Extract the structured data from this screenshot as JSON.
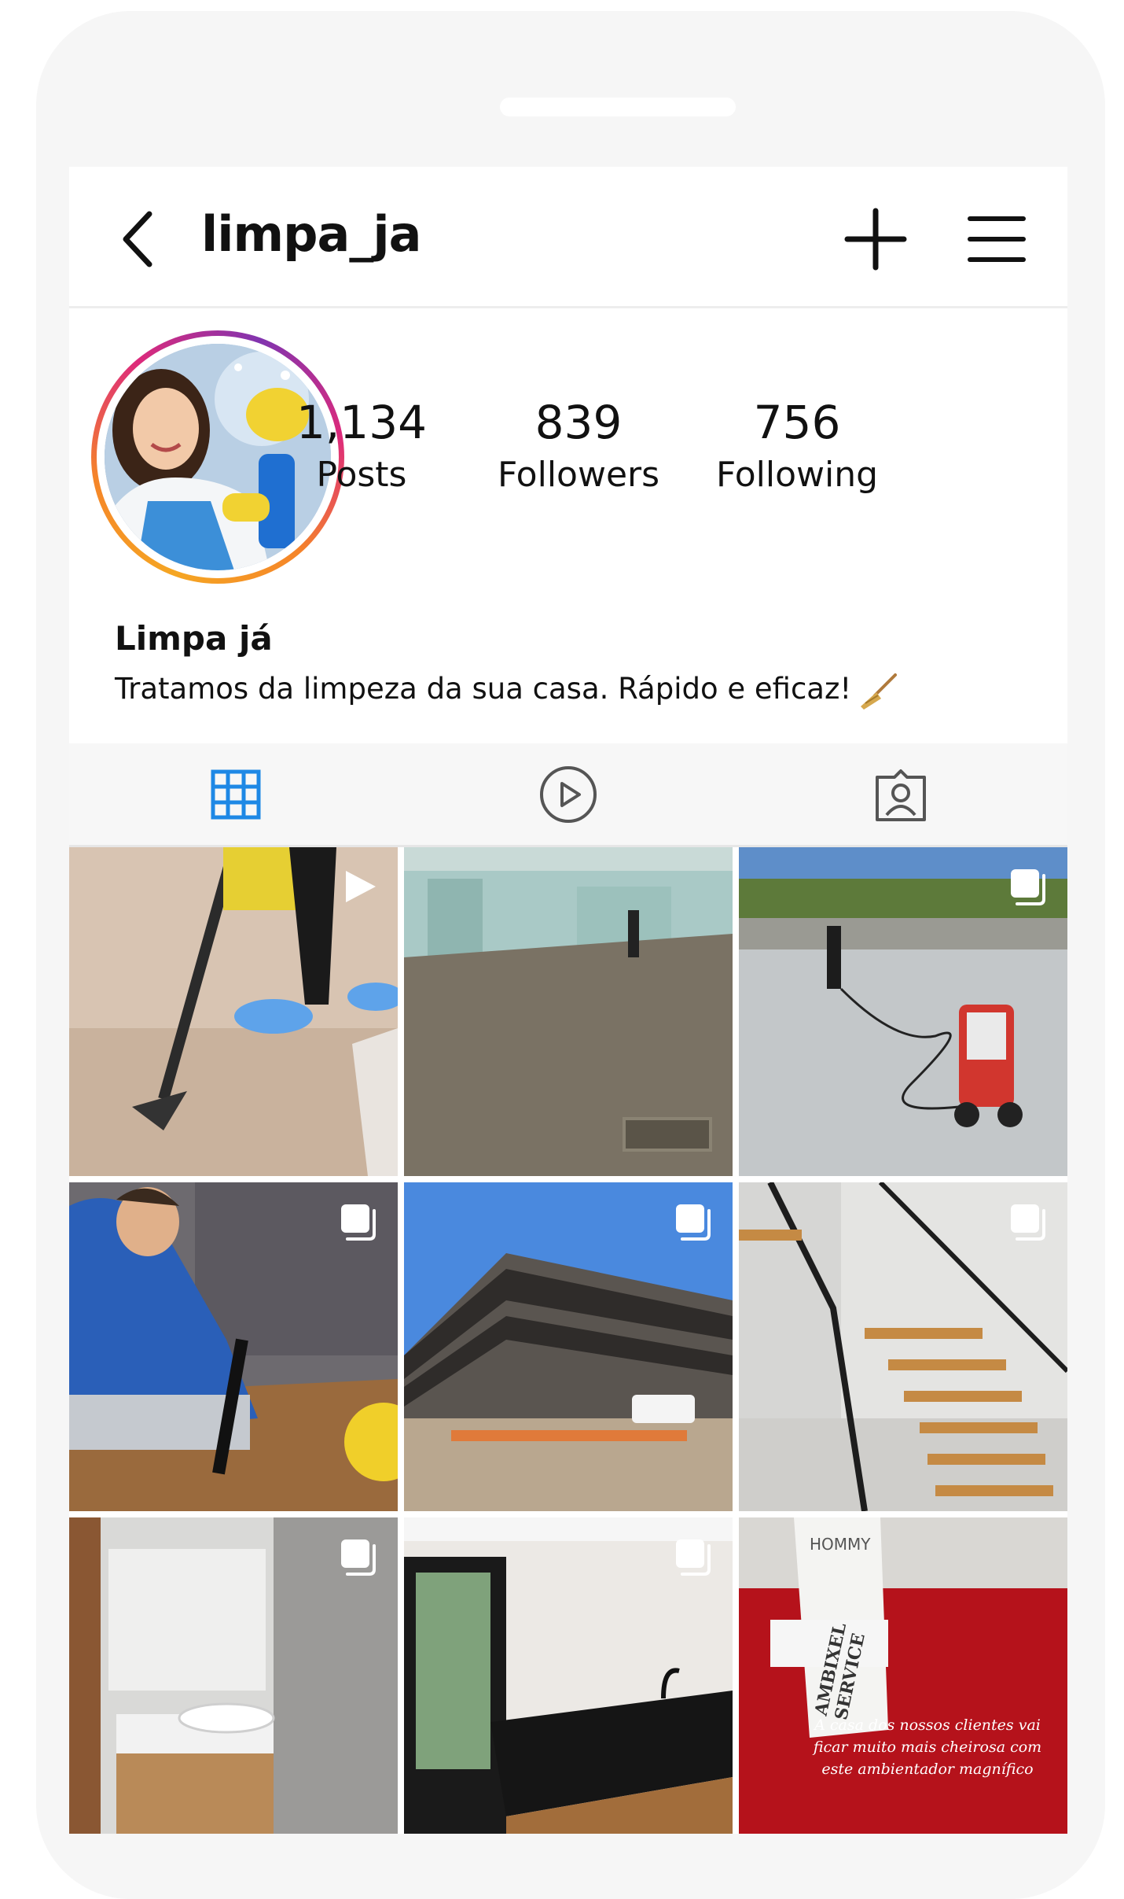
{
  "header": {
    "username": "limpa_ja"
  },
  "profile": {
    "stats": [
      {
        "value": "1,134",
        "label": "Posts"
      },
      {
        "value": "839",
        "label": "Followers"
      },
      {
        "value": "756",
        "label": "Following"
      }
    ],
    "display_name": "Limpa já",
    "bio": "Tratamos da limpeza da sua casa. Rápido e eficaz!"
  },
  "tabs": [
    {
      "icon": "grid-icon",
      "active": true
    },
    {
      "icon": "reels-play-icon",
      "active": false
    },
    {
      "icon": "tagged-person-icon",
      "active": false
    }
  ],
  "colors": {
    "accent_active_tab": "#1e88e5",
    "ring_start": "#f58529",
    "ring_mid": "#dd2a7b",
    "ring_end": "#8134af"
  },
  "posts": [
    {
      "badge": "video-icon"
    },
    {
      "badge": "none"
    },
    {
      "badge": "carousel-icon"
    },
    {
      "badge": "carousel-icon"
    },
    {
      "badge": "carousel-icon"
    },
    {
      "badge": "carousel-icon"
    },
    {
      "badge": "carousel-icon"
    },
    {
      "badge": "carousel-icon"
    },
    {
      "badge": "none"
    }
  ],
  "post_overlay_text": {
    "bottle_brand": "HOMMY",
    "bottle_label": "AMBIXEL SERVICE",
    "caption": "A casa dos nossos clientes vai ficar muito mais cheirosa com este ambientador magnífico"
  }
}
